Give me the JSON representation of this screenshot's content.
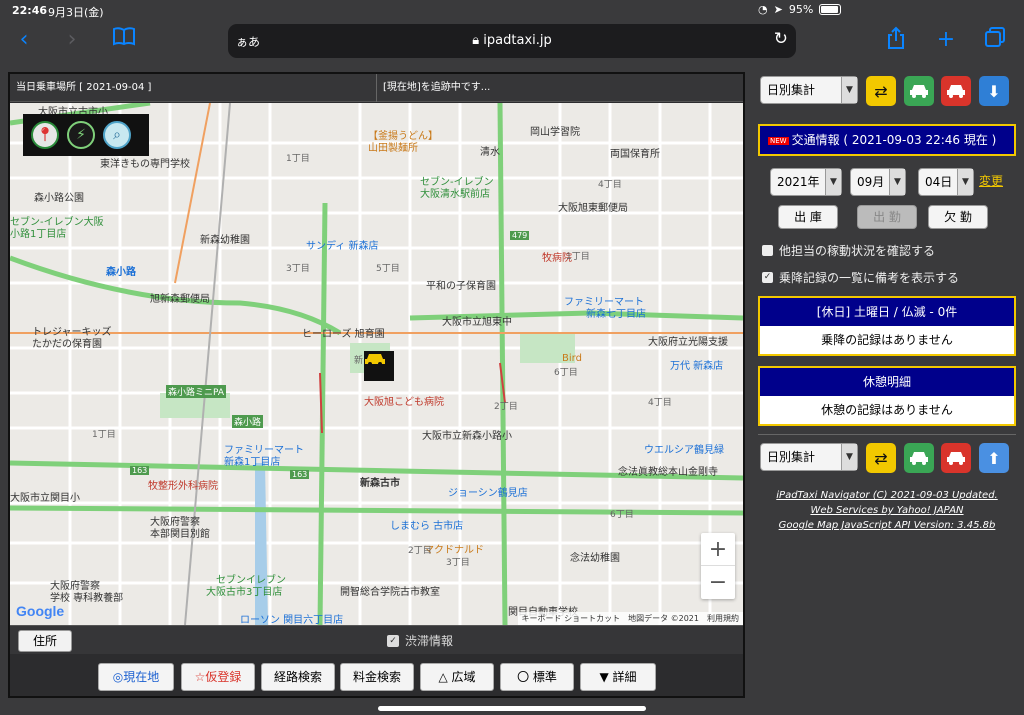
{
  "status": {
    "time": "22:46",
    "date": "9月3日(金)",
    "battery": "95%"
  },
  "browser": {
    "aa": "ぁあ",
    "url": "ipadtaxi.jp"
  },
  "map_panel": {
    "header_left": "当日乗車場所 [ 2021-09-04 ]",
    "header_right": "[現在地]を追跡中です...",
    "address_button": "住所",
    "traffic_label": "渋滞情報",
    "attribution": "キーボード ショートカット　地図データ ©2021　利用規約",
    "google": "Google",
    "labels": {
      "osaka_shiritsu_furuichi": "大阪市立古市小",
      "higashiyodo_school": "東洋きもの専門学校",
      "morishoji_park": "森小路公園",
      "seven_osaka": "セブン-イレブン大阪",
      "koji1": "小路1丁目店",
      "shinmori_kindergarten": "新森幼稚園",
      "morishoji_station": "森小路",
      "asahi_post": "旭新森郵便局",
      "treasure_kids": "トレジャーキッズ",
      "takadai": "たかだの保育園",
      "kamaage_udon": "【釜揚うどん】",
      "yamada_seimen": "山田製麺所",
      "shimizu": "清水",
      "okayama_school": "岡山学習院",
      "ryogoku_nursery": "両国保育所",
      "seven_shimizu": "セブン-イレブン",
      "shimizu_station": "大阪清水駅前店",
      "shinmori_east_post": "大阪旭東郵便局",
      "sundi": "サンディ 新森店",
      "maki_hospital": "牧病院",
      "heiwa_nursery": "平和の子保育園",
      "familymart_shinmori7": "ファミリーマート",
      "shinmori7": "新森七丁目店",
      "heroes": "ヒーローズ 旭育園",
      "asahi_higashi_middle": "大阪市立旭東中",
      "kofu_school": "大阪府立光陽支援",
      "bird": "Bird",
      "mandai": "万代 新森店",
      "asahi_children": "大阪旭こども病院",
      "shinmori_elementary": "大阪市立新森小路小",
      "ueshia": "ウエルシア鶴見緑",
      "familymart_shinmori": "ファミリーマート",
      "shinmori_1": "新森1丁目店",
      "morishoji_mini": "森小路ミニPA",
      "morishoji_sign": "森小路",
      "route163_a": "163",
      "route163_b": "163",
      "route163_c": "163",
      "route479": "479",
      "kaneda_dental": "念法眞教総本山金剛寺",
      "makiseikei": "牧整形外科病院",
      "shinmori_furuichi": "新森古市",
      "joshin": "ジョーシン鶴見店",
      "sekime_school": "大阪市立関目小",
      "police_hq": "大阪府警察",
      "police_jpn": "本部関目別館",
      "shimamura": "しまむら 古市店",
      "mcdonalds": "マクドナルド",
      "hoho_nursery": "念法幼稚園",
      "police_school": "大阪府警察",
      "police_school2": "学校 専科教養部",
      "seven_furuichi": "セブンイレブン",
      "furuichi3": "大阪古市3丁目店",
      "kaimei": "開智総合学院古市教室",
      "lawson": "ローソン 関目六丁目店",
      "sekime_driving": "関目自動車学校",
      "chome1a": "1丁目",
      "chome3a": "3丁目",
      "chome5a": "5丁目",
      "chome6a": "6丁目",
      "chome4a": "4丁目",
      "chome1b": "1丁目",
      "chome2a": "2丁目",
      "chome4b": "4丁目",
      "chome1c": "1丁目",
      "chome3b": "3丁目",
      "chome6b": "6丁目",
      "chome2b": "2丁目",
      "shinmori": "新"
    }
  },
  "map_toolbar": [
    "◎現在地",
    "☆仮登録",
    "経路検索",
    "料金検索",
    "△ 広域",
    "〇 標準",
    "▼ 詳細"
  ],
  "right_panel": {
    "select_top": "日別集計",
    "select_bottom": "日別集計",
    "news_badge": "NEW",
    "news_text": "交通情報 ( 2021-09-03 22:46 現在 )",
    "year": "2021年",
    "month": "09月",
    "day": "04日",
    "change_link": "変更",
    "btn_out": "出 庫",
    "btn_attend": "出 勤",
    "btn_absent": "欠 勤",
    "opt1": "他担当の稼動状況を確認する",
    "opt2": "乗降記録の一覧に備考を表示する",
    "card1_head": "[休日] 土曜日 / 仏滅 - 0件",
    "card1_body": "乗降の記録はありません",
    "card2_head": "休憩明細",
    "card2_body": "休憩の記録はありません",
    "credit1": "iPadTaxi Navigator (C)  2021-09-03 Updated.",
    "credit2": "Web Services by Yahoo! JAPAN",
    "credit3": "Google Map JavaScript API Version: 3.45.8b"
  },
  "colors": {
    "accent": "#0a84ff",
    "news_bg": "#00008b",
    "news_border": "#f2c800",
    "refresh": "#f2c800",
    "green_taxi": "#3aa655",
    "red_taxi": "#d9342b",
    "download": "#2f7fd6"
  }
}
